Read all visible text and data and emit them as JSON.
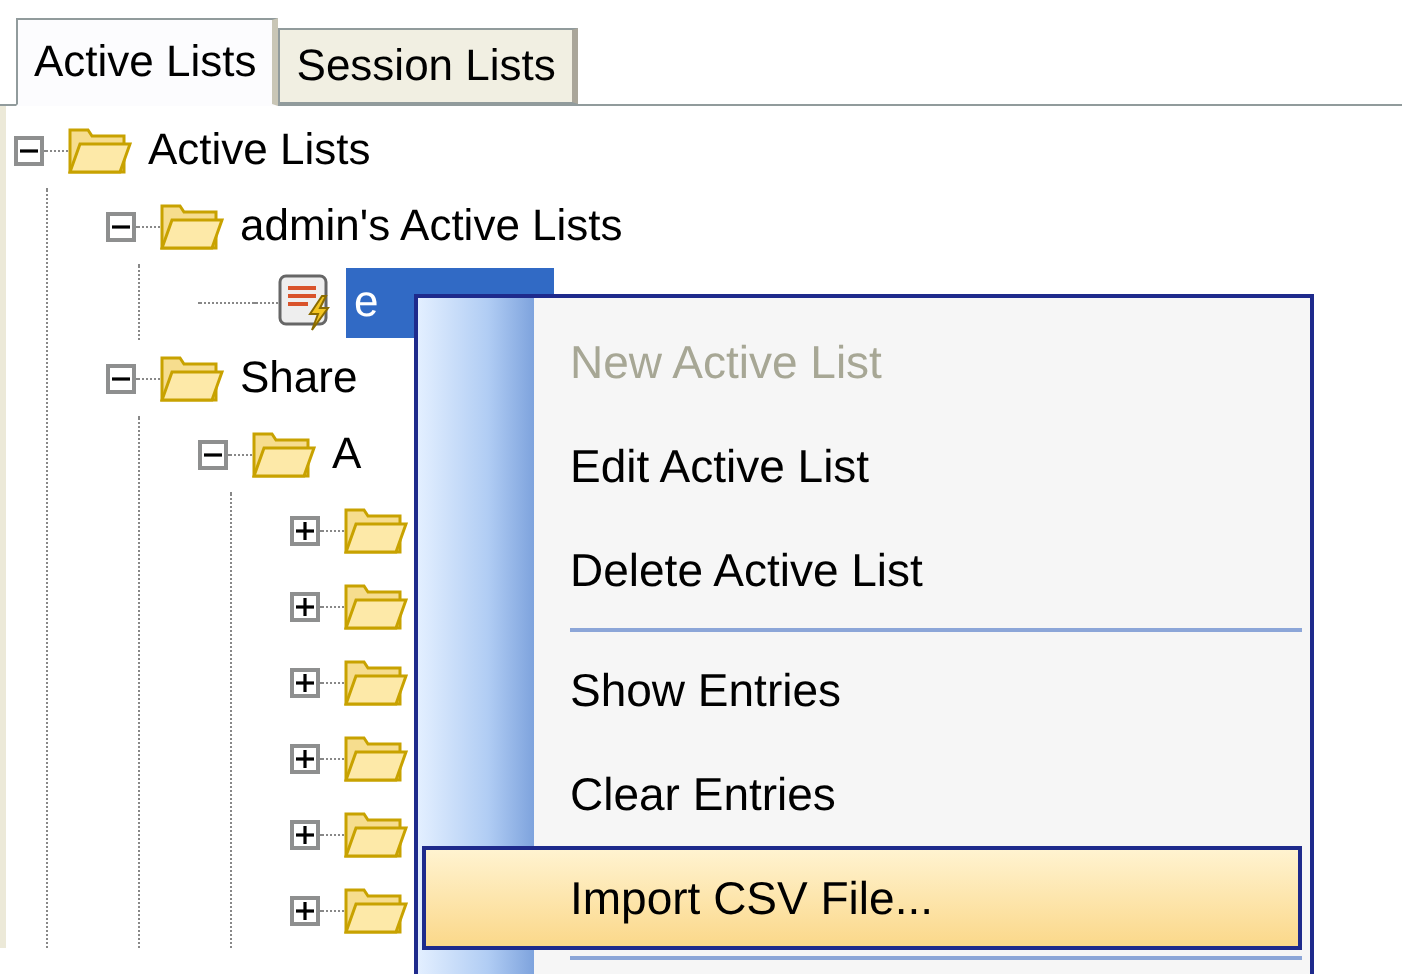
{
  "tabs": [
    {
      "label": "Active Lists",
      "selected": true
    },
    {
      "label": "Session Lists",
      "selected": false
    }
  ],
  "tree": [
    {
      "kind": "folder",
      "label": "Active Lists",
      "expanded": true,
      "selected": false,
      "children": [
        {
          "kind": "folder",
          "label": "admin's Active Lists",
          "expanded": true,
          "selected": false,
          "children": [
            {
              "kind": "list",
              "label": "e",
              "selected": true
            }
          ]
        },
        {
          "kind": "folder",
          "label": "Share",
          "expanded": true,
          "selected": false,
          "children": [
            {
              "kind": "folder",
              "label": "A",
              "expanded": true,
              "selected": false,
              "children": [
                {
                  "kind": "folder",
                  "expanded": false,
                  "selected": false
                },
                {
                  "kind": "folder",
                  "expanded": false,
                  "selected": false
                },
                {
                  "kind": "folder",
                  "expanded": false,
                  "selected": false
                },
                {
                  "kind": "folder",
                  "expanded": false,
                  "selected": false
                },
                {
                  "kind": "folder",
                  "expanded": false,
                  "selected": false
                },
                {
                  "kind": "folder",
                  "expanded": false,
                  "selected": false
                }
              ]
            }
          ]
        }
      ]
    }
  ],
  "context_menu": [
    {
      "kind": "item",
      "label": "New Active List",
      "disabled": true,
      "selected": false
    },
    {
      "kind": "item",
      "label": "Edit Active List",
      "disabled": false,
      "selected": false
    },
    {
      "kind": "item",
      "label": "Delete Active List",
      "disabled": false,
      "selected": false
    },
    {
      "kind": "separator"
    },
    {
      "kind": "item",
      "label": "Show Entries",
      "disabled": false,
      "selected": false
    },
    {
      "kind": "item",
      "label": "Clear Entries",
      "disabled": false,
      "selected": false
    },
    {
      "kind": "item",
      "label": "Import CSV File...",
      "disabled": false,
      "selected": true
    },
    {
      "kind": "separator"
    }
  ]
}
